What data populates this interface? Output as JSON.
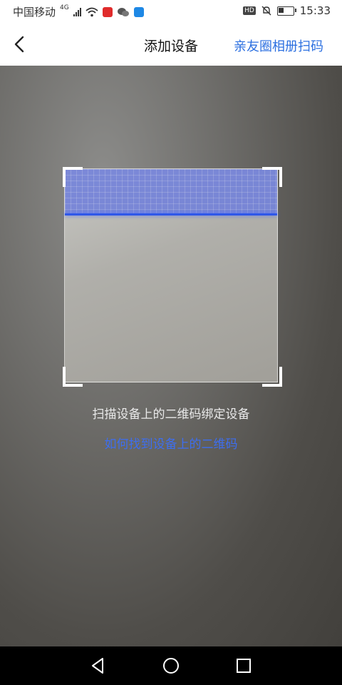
{
  "status_bar": {
    "carrier": "中国移动",
    "network": "4G",
    "time": "15:33",
    "hd_label": "HD",
    "battery_level": 0.35,
    "icons": [
      "signal-icon",
      "wifi-icon",
      "video-app-icon",
      "wechat-icon",
      "location-app-icon",
      "mute-bell-icon",
      "battery-icon"
    ]
  },
  "header": {
    "title": "添加设备",
    "action_label": "亲友圈相册扫码",
    "back_icon": "chevron-left-icon",
    "accent_color": "#2b6fe0"
  },
  "scanner": {
    "hint_text": "扫描设备上的二维码绑定设备",
    "help_link": "如何找到设备上的二维码",
    "scan_line_color": "#2f57e8"
  },
  "nav_bar": {
    "icons": [
      "back-triangle-icon",
      "home-circle-icon",
      "recents-square-icon"
    ]
  }
}
